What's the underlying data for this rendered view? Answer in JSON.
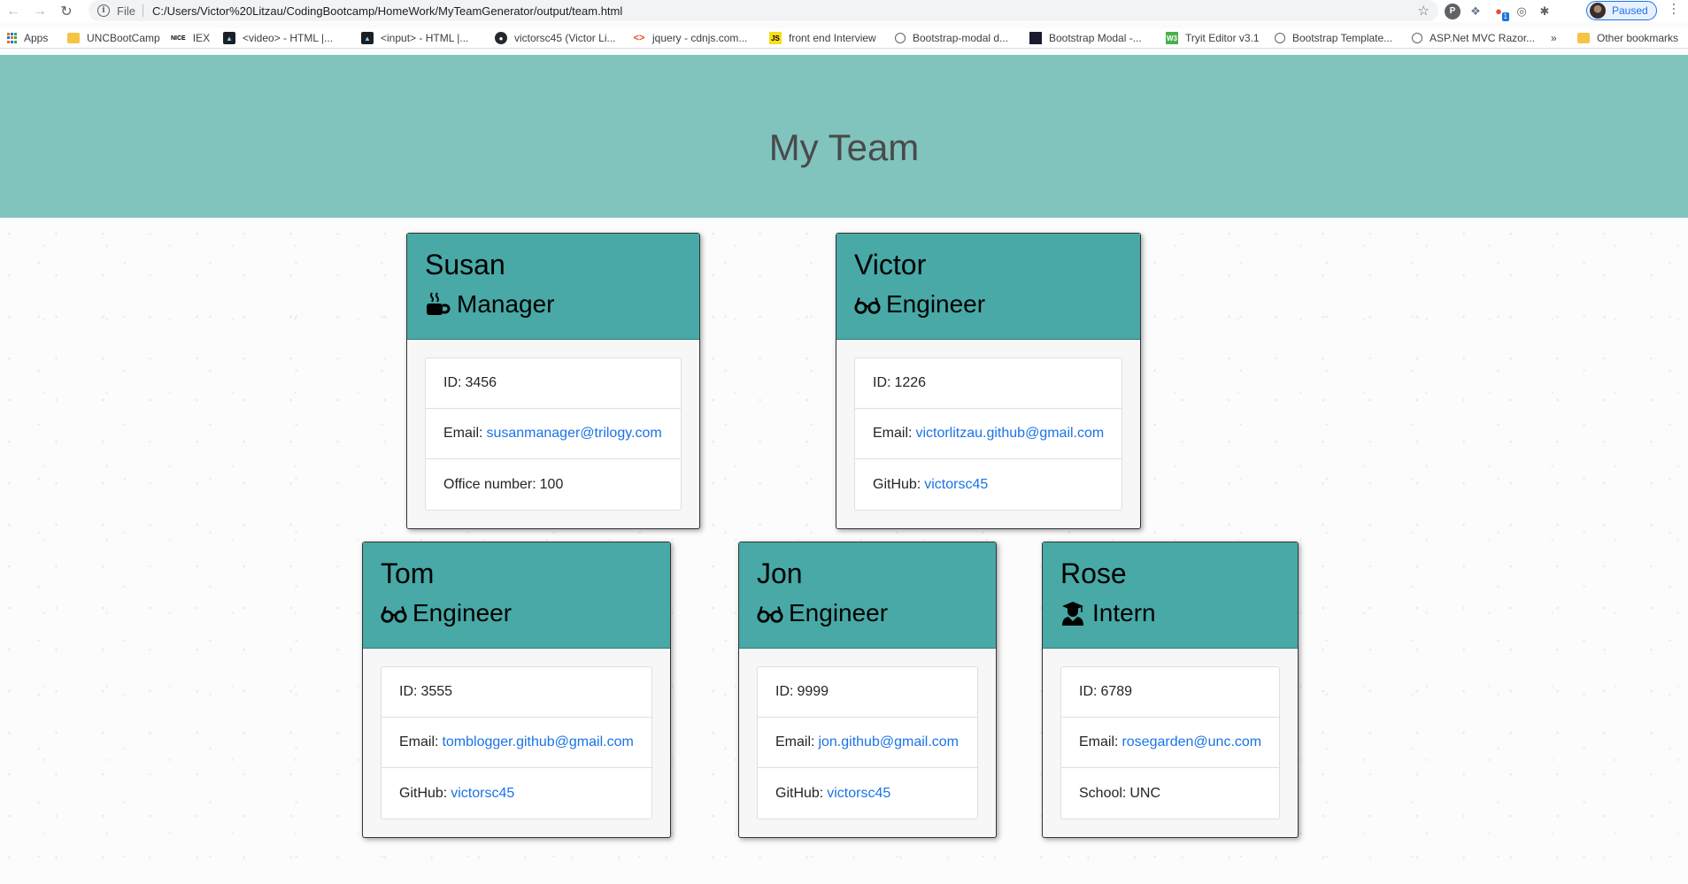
{
  "browser": {
    "protocol_label": "File",
    "url": "C:/Users/Victor%20Litzau/CodingBootcamp/HomeWork/MyTeamGenerator/output/team.html",
    "profile_status": "Paused",
    "bookmarks": [
      {
        "label": "Apps",
        "icon": "apps-icon"
      },
      {
        "label": "UNCBootCamp",
        "icon": "folder-icon"
      },
      {
        "label": "IEX",
        "icon": "nice-icon"
      },
      {
        "label": "<video> - HTML |...",
        "icon": "mdn-icon"
      },
      {
        "label": "<input> - HTML |...",
        "icon": "mdn-icon"
      },
      {
        "label": "victorsc45 (Victor Li...",
        "icon": "github-icon"
      },
      {
        "label": "jquery - cdnjs.com...",
        "icon": "code-icon"
      },
      {
        "label": "front end Interview",
        "icon": "js-icon"
      },
      {
        "label": "Bootstrap-modal d...",
        "icon": "globe-icon"
      },
      {
        "label": "Bootstrap Modal -...",
        "icon": "bootstrap-icon"
      },
      {
        "label": "Tryit Editor v3.1",
        "icon": "tryit-icon"
      },
      {
        "label": "Bootstrap Template...",
        "icon": "globe-icon"
      },
      {
        "label": "ASP.Net MVC Razor...",
        "icon": "globe-icon"
      },
      {
        "label": "»",
        "icon": ""
      },
      {
        "label": "Other bookmarks",
        "icon": "folder-icon"
      }
    ]
  },
  "header": {
    "title": "My Team"
  },
  "team": [
    {
      "name": "Susan",
      "role": "Manager",
      "role_icon": "mug-hot-icon",
      "id_label": "ID:",
      "id": "3456",
      "email_label": "Email:",
      "email": "susanmanager@trilogy.com",
      "extra_label": "Office number:",
      "extra": "100",
      "extra_is_link": false
    },
    {
      "name": "Victor",
      "role": "Engineer",
      "role_icon": "glasses-icon",
      "id_label": "ID:",
      "id": "1226",
      "email_label": "Email:",
      "email": "victorlitzau.github@gmail.com",
      "extra_label": "GitHub:",
      "extra": "victorsc45",
      "extra_is_link": true
    },
    {
      "name": "Tom",
      "role": "Engineer",
      "role_icon": "glasses-icon",
      "id_label": "ID:",
      "id": "3555",
      "email_label": "Email:",
      "email": "tomblogger.github@gmail.com",
      "extra_label": "GitHub:",
      "extra": "victorsc45",
      "extra_is_link": true
    },
    {
      "name": "Jon",
      "role": "Engineer",
      "role_icon": "glasses-icon",
      "id_label": "ID:",
      "id": "9999",
      "email_label": "Email:",
      "email": "jon.github@gmail.com",
      "extra_label": "GitHub:",
      "extra": "victorsc45",
      "extra_is_link": true
    },
    {
      "name": "Rose",
      "role": "Intern",
      "role_icon": "user-graduate-icon",
      "id_label": "ID:",
      "id": "6789",
      "email_label": "Email:",
      "email": "rosegarden@unc.com",
      "extra_label": "School:",
      "extra": "UNC",
      "extra_is_link": false
    }
  ],
  "colors": {
    "jumbotron": "#80c4bd",
    "card_header": "#48a9a6",
    "link": "#1a73e8"
  }
}
